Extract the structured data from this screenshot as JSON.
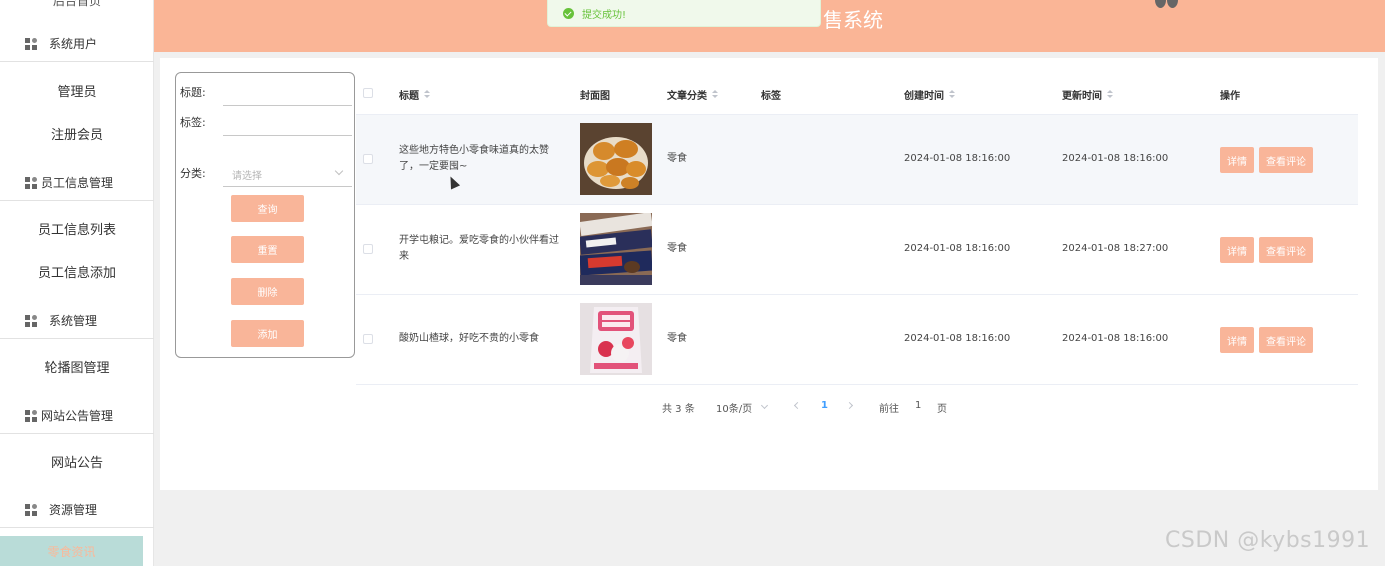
{
  "sidebar": {
    "top_item": "后台首页",
    "groups": [
      {
        "label": "系统用户",
        "children": [
          "管理员",
          "注册会员"
        ]
      },
      {
        "label": "员工信息管理",
        "children": [
          "员工信息列表",
          "员工信息添加"
        ]
      },
      {
        "label": "系统管理",
        "children": [
          "轮播图管理"
        ]
      },
      {
        "label": "网站公告管理",
        "children": [
          "网站公告"
        ]
      },
      {
        "label": "资源管理",
        "children": []
      }
    ],
    "active_item": "零食资讯"
  },
  "header": {
    "title": "售系统"
  },
  "toast": {
    "message": "提交成功!",
    "color": "#67c23a"
  },
  "search_form": {
    "title_label": "标题:",
    "tag_label": "标签:",
    "category_label": "分类:",
    "category_placeholder": "请选择",
    "buttons": {
      "query": "查询",
      "reset": "重置",
      "delete": "删除",
      "add": "添加"
    }
  },
  "table": {
    "columns": [
      "标题",
      "封面图",
      "文章分类",
      "标签",
      "创建时间",
      "更新时间",
      "操作"
    ],
    "rows": [
      {
        "title": "这些地方特色小零食味道真的太赞了，一定要囤~",
        "category": "零食",
        "tag": "",
        "created": "2024-01-08 18:16:00",
        "updated": "2024-01-08 18:16:00",
        "cover": "dumpling-snack-image"
      },
      {
        "title": "开学屯粮记。爱吃零食的小伙伴看过来",
        "category": "零食",
        "tag": "",
        "created": "2024-01-08 18:16:00",
        "updated": "2024-01-08 18:27:00",
        "cover": "chocolate-bar-image"
      },
      {
        "title": "酸奶山楂球，好吃不贵的小零食",
        "category": "零食",
        "tag": "",
        "created": "2024-01-08 18:16:00",
        "updated": "2024-01-08 18:16:00",
        "cover": "yogurt-hawthorn-package-image"
      }
    ],
    "actions": {
      "detail": "详情",
      "comments": "查看评论"
    }
  },
  "pagination": {
    "total": "共 3 条",
    "page_size": "10条/页",
    "current_page": "1",
    "goto_label": "前往",
    "goto_value": "1",
    "page_suffix": "页"
  },
  "watermark": "CSDN @kybs1991",
  "colors": {
    "header": "#fab596",
    "button": "#f9b599",
    "active_sidebar": "#b9dcd8"
  }
}
